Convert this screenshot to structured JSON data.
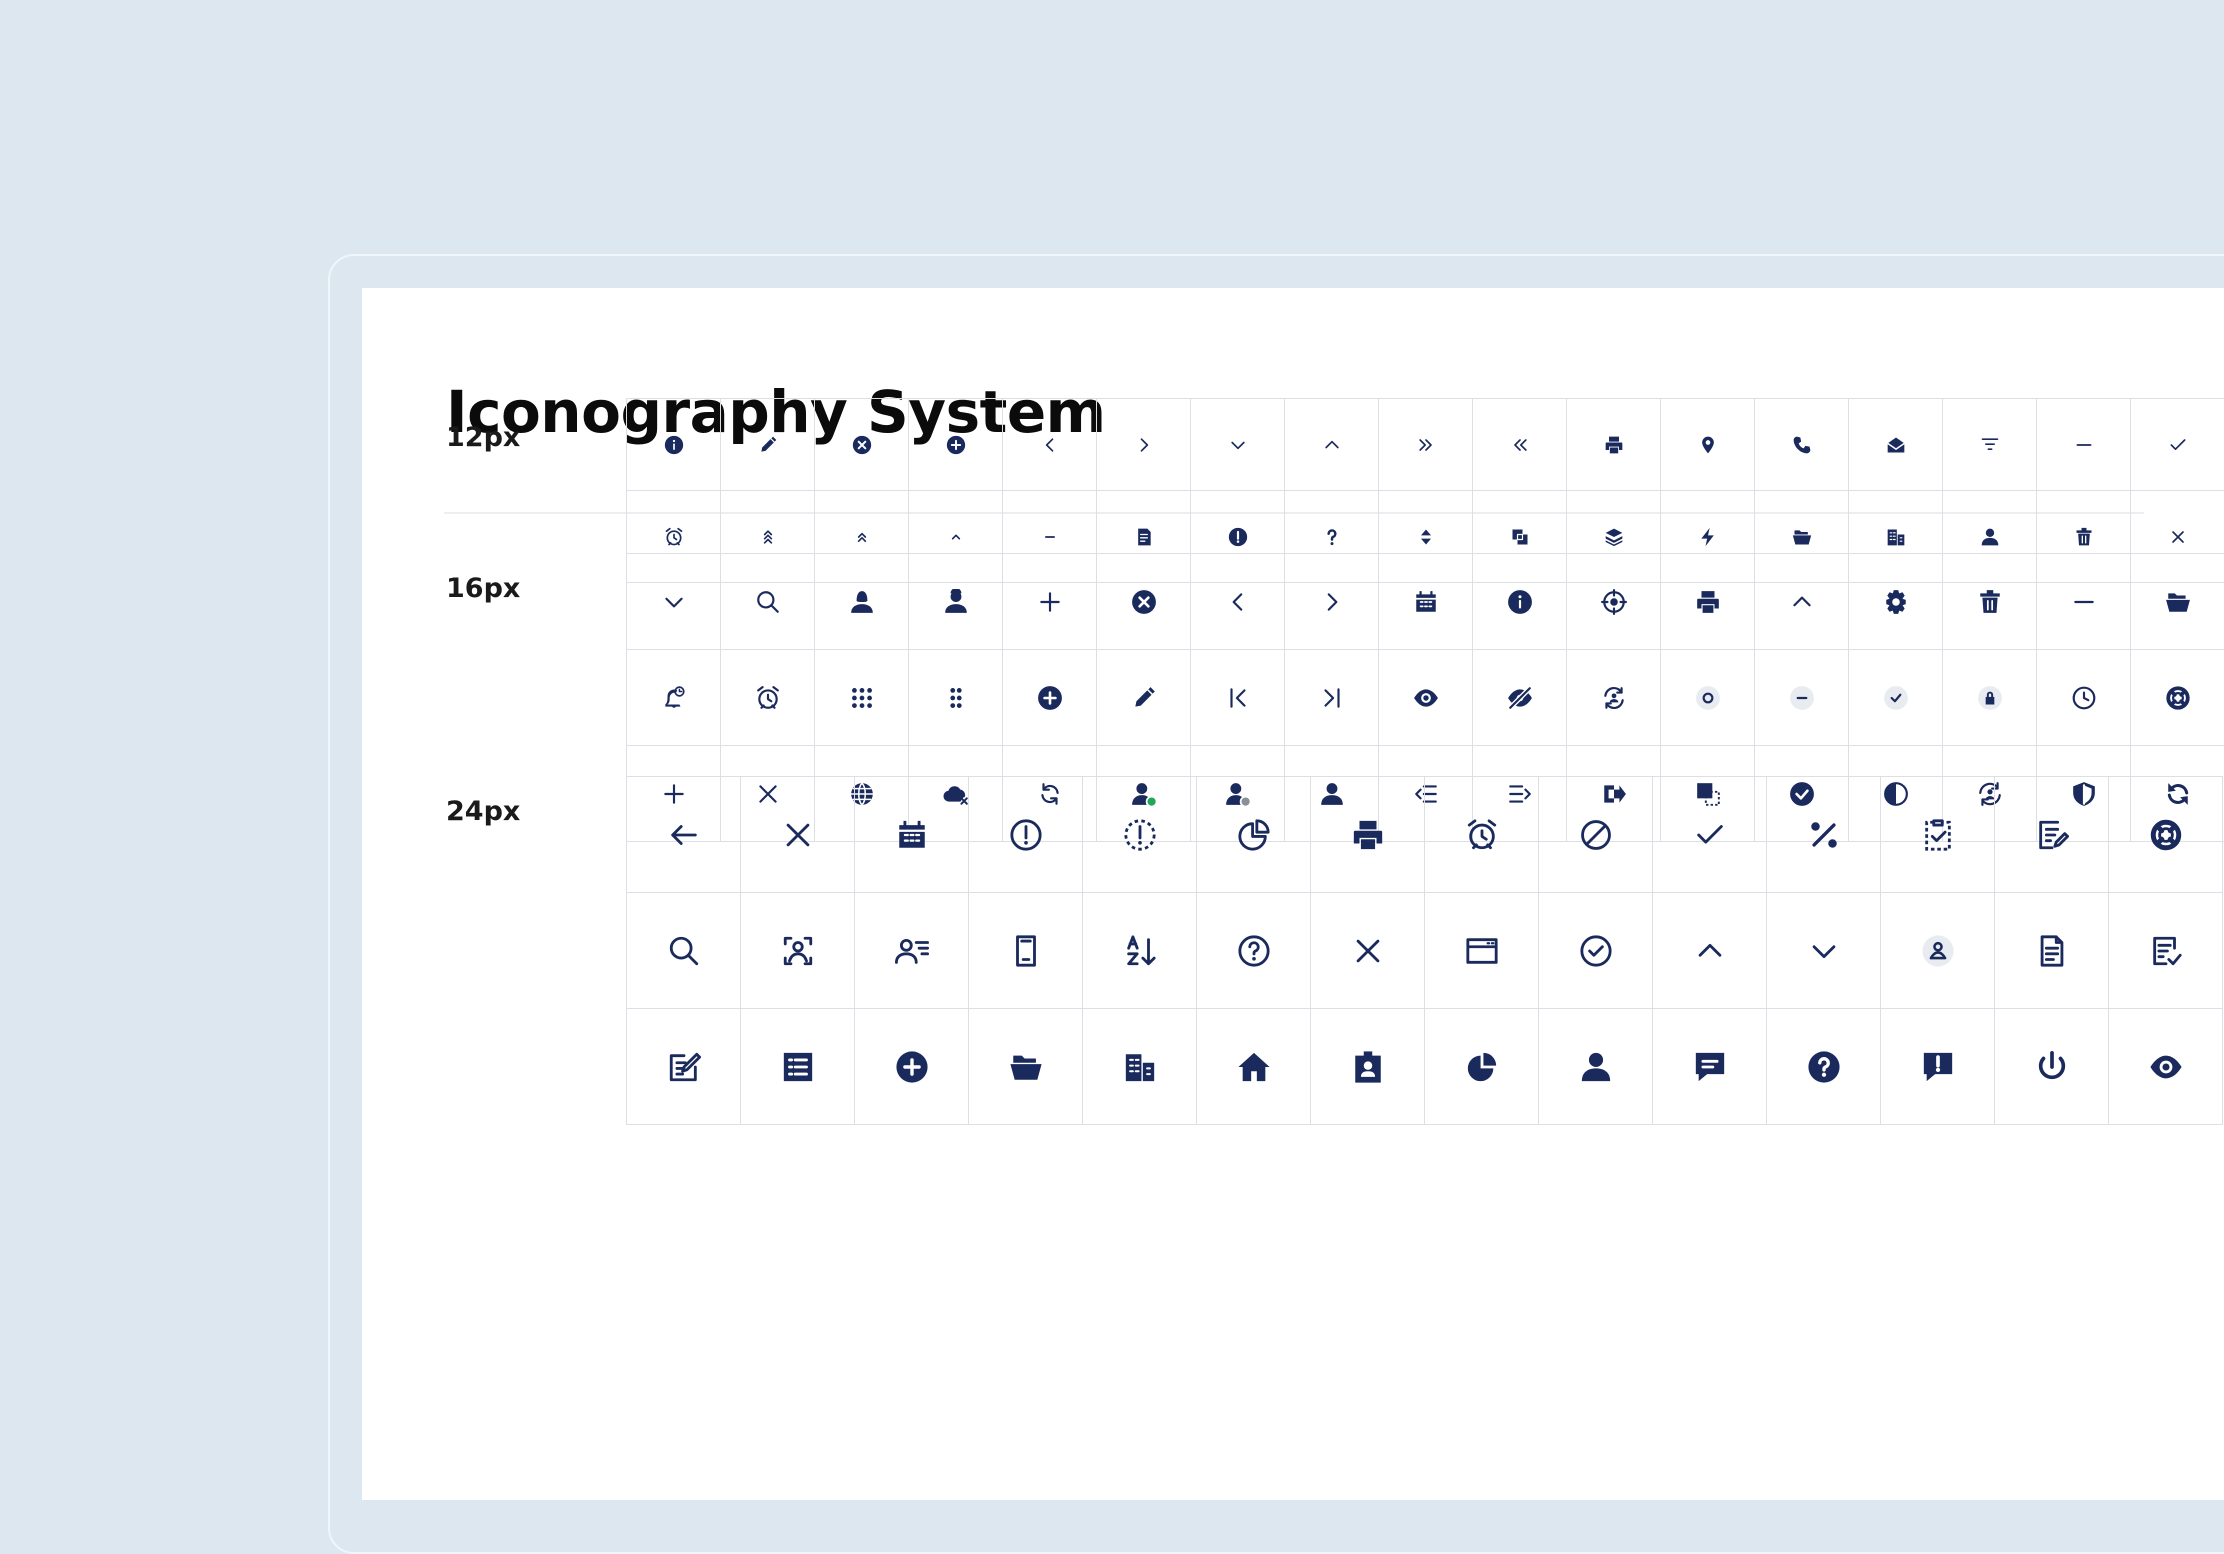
{
  "title": "Iconography System",
  "colors": {
    "background": "#dce7f0",
    "card": "#ffffff",
    "icon": "#1b2a5c",
    "grid_line": "#dcdfe3",
    "status_online": "#22a65a",
    "status_away": "#8a8f98",
    "disc_bg": "#e8ecf1"
  },
  "groups": [
    {
      "label": "12px",
      "rows": [
        [
          "info-filled",
          "pencil",
          "close-circle-filled",
          "plus-circle-filled",
          "chevron-left",
          "chevron-right",
          "chevron-down",
          "chevron-up",
          "double-chevron-right",
          "double-chevron-left",
          "printer",
          "map-pin",
          "phone",
          "mail-open",
          "filter-lines",
          "minus",
          "check"
        ],
        [
          "alarm-clock",
          "triple-chevron-up",
          "double-chevron-up",
          "chevron-up-small",
          "minus-small",
          "document-filled",
          "exclamation-circle-filled",
          "question-mark",
          "sort-vertical",
          "copy-filled",
          "layers",
          "lightning",
          "folder-open",
          "buildings",
          "user",
          "trash",
          "close-small"
        ]
      ]
    },
    {
      "label": "16px",
      "rows": [
        [
          "chevron-down",
          "search",
          "user-female",
          "user-male",
          "plus",
          "close-circle-filled",
          "chevron-left",
          "chevron-right",
          "calendar",
          "info-filled",
          "target",
          "printer",
          "chevron-up",
          "gear",
          "trash",
          "minus",
          "folder-open"
        ],
        [
          "bell-clock",
          "alarm-clock",
          "grid-dots-9",
          "grid-dots-6",
          "plus-circle-filled",
          "pencil",
          "first-page",
          "last-page",
          "eye",
          "eye-off",
          "sync-user",
          "status-empty",
          "status-minus",
          "status-check",
          "status-lock",
          "clock",
          "lifebuoy"
        ],
        [
          "plus",
          "close",
          "globe",
          "cloud-close",
          "refresh",
          "user-online",
          "user-away",
          "user",
          "indent-left",
          "indent-right",
          "sign-out",
          "select-copy",
          "check-circle-filled",
          "contrast",
          "sync-user-arrows",
          "shield",
          "refresh-filled"
        ]
      ]
    },
    {
      "label": "24px",
      "rows": [
        [
          "arrow-left",
          "close",
          "calendar",
          "exclamation-circle",
          "exclamation-circle-dashed",
          "pie-chart-outline",
          "printer",
          "alarm-clock",
          "ban",
          "check",
          "percent",
          "clipboard-check",
          "edit-document",
          "lifebuoy"
        ],
        [
          "search",
          "face-scan",
          "user-list",
          "smartphone",
          "sort-alpha-down",
          "question-circle",
          "close",
          "browser-window",
          "check-circle",
          "chevron-up",
          "chevron-down",
          "user-badge",
          "document-lines",
          "document-check"
        ],
        [
          "edit-square",
          "list-box",
          "plus-circle-filled",
          "folder-open",
          "buildings",
          "home",
          "id-badge",
          "pie-chart-filled",
          "user",
          "chat-message",
          "question-circle-filled",
          "chat-alert",
          "power",
          "eye"
        ]
      ]
    }
  ]
}
